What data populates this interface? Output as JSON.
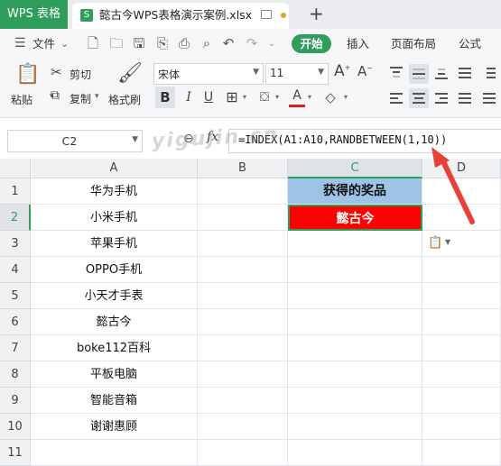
{
  "titlebar": {
    "app_label": "WPS 表格",
    "doc_title": "懿古今WPS表格演示案例.xlsx",
    "new_tab": "+"
  },
  "menu": {
    "file": "文件",
    "tabs": [
      "开始",
      "插入",
      "页面布局",
      "公式"
    ]
  },
  "ribbon": {
    "paste": "粘贴",
    "cut": "剪切",
    "copy": "复制",
    "format_painter": "格式刷",
    "font_name": "宋体",
    "font_size": "11",
    "bold": "B",
    "italic": "I",
    "underline": "U",
    "grow_font": "A",
    "shrink_font": "A"
  },
  "formula_bar": {
    "name_box": "C2",
    "fx": "fx",
    "formula": "=INDEX(A1:A10,RANDBETWEEN(1,10))"
  },
  "watermark": "yigujin.cn",
  "sheet": {
    "columns": [
      "A",
      "B",
      "C",
      "D"
    ],
    "rows": [
      "1",
      "2",
      "3",
      "4",
      "5",
      "6",
      "7",
      "8",
      "9",
      "10",
      "11"
    ],
    "col_a": [
      "华为手机",
      "小米手机",
      "苹果手机",
      "OPPO手机",
      "小天才手表",
      "懿古今",
      "boke112百科",
      "平板电脑",
      "智能音箱",
      "谢谢惠顾",
      ""
    ],
    "c1": "获得的奖品",
    "c2": "懿古今",
    "colors": {
      "header_fill": "#9dc3e6",
      "result_fill": "#ff0000",
      "selection": "#2f9d5c",
      "arrow": "#e8413a"
    }
  }
}
